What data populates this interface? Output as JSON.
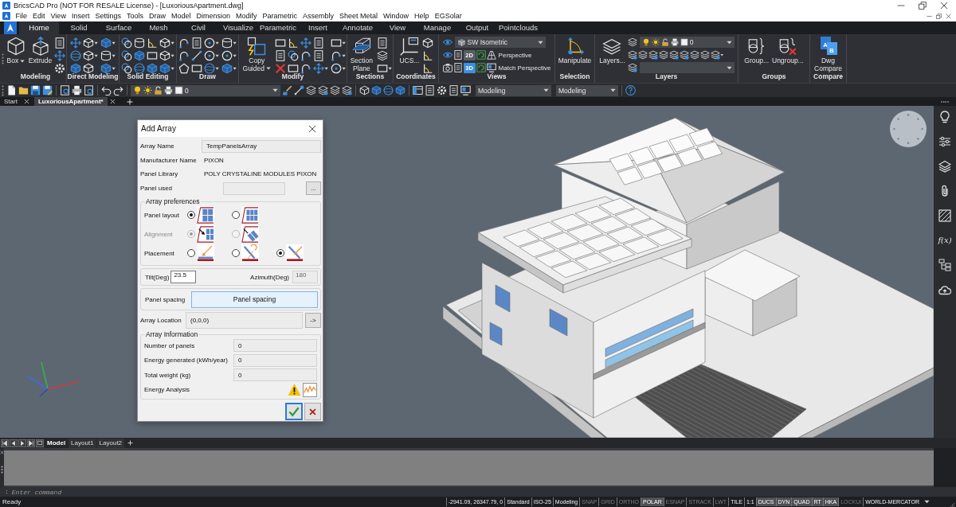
{
  "window": {
    "title": "BricsCAD Pro (NOT FOR RESALE License) - [LuxoriousApartment.dwg]"
  },
  "menu_bar": [
    "File",
    "Edit",
    "View",
    "Insert",
    "Settings",
    "Tools",
    "Draw",
    "Model",
    "Dimension",
    "Modify",
    "Parametric",
    "Assembly",
    "Sheet Metal",
    "Window",
    "Help",
    "EGSolar"
  ],
  "ribbon_tabs": [
    {
      "label": "Home",
      "selected": true
    },
    {
      "label": "Solid",
      "selected": false
    },
    {
      "label": "Surface",
      "selected": false
    },
    {
      "label": "Mesh",
      "selected": false
    },
    {
      "label": "Civil",
      "selected": false
    },
    {
      "label": "Visualize",
      "selected": false
    },
    {
      "label": "Parametric",
      "selected": false
    },
    {
      "label": "Insert",
      "selected": false
    },
    {
      "label": "Annotate",
      "selected": false
    },
    {
      "label": "View",
      "selected": false
    },
    {
      "label": "Manage",
      "selected": false
    },
    {
      "label": "Output",
      "selected": false
    },
    {
      "label": "Pointclouds",
      "selected": false
    }
  ],
  "ribbon_groups": [
    {
      "kind": "buttons",
      "label": "Modeling",
      "buttons": [
        {
          "label": "Box",
          "dropdown": true
        },
        {
          "label": "Extrude",
          "dropdown": false
        }
      ]
    },
    {
      "kind": "buttons",
      "label": "Direct Modeling"
    },
    {
      "kind": "buttons",
      "label": "Solid Editing"
    },
    {
      "kind": "buttons",
      "label": "Draw"
    },
    {
      "kind": "buttons",
      "label": "Modify",
      "buttons": [
        {
          "label": "Copy Guided",
          "dropdown": true
        }
      ]
    },
    {
      "kind": "buttons",
      "label": "Sections",
      "buttons": [
        {
          "label": "Section Plane",
          "dropdown": false
        }
      ]
    },
    {
      "kind": "buttons",
      "label": "Coordinates",
      "buttons": [
        {
          "label": "UCS...",
          "dropdown": false
        }
      ]
    },
    {
      "kind": "views",
      "label": "Views",
      "view": "SW Isometric",
      "modes": [
        {
          "label": "2D",
          "selected": false
        },
        {
          "label": "3D",
          "selected": true
        }
      ],
      "options": [
        "Perspective",
        "Match Perspective"
      ]
    },
    {
      "kind": "buttons",
      "label": "Selection",
      "buttons": [
        {
          "label": "Manipulate",
          "dropdown": false
        }
      ]
    },
    {
      "kind": "layers",
      "label": "Layers",
      "buttons": [
        {
          "label": "Layers...",
          "dropdown": false
        }
      ],
      "layer": "0"
    },
    {
      "kind": "buttons",
      "label": "Groups",
      "buttons": [
        {
          "label": "Group...",
          "dropdown": false
        },
        {
          "label": "Ungroup...",
          "dropdown": false
        }
      ]
    },
    {
      "kind": "buttons",
      "label": "Compare",
      "buttons": [
        {
          "label": "Dwg Compare",
          "dropdown": false,
          "icon_letters": [
            "A",
            "B"
          ]
        }
      ]
    }
  ],
  "quick_toolbar": {
    "layer": "0",
    "combos": [
      "Modeling",
      "Modeling"
    ]
  },
  "document_tabs": [
    {
      "label": "Start",
      "selected": false
    },
    {
      "label": "LuxoriousApartment*",
      "selected": true
    }
  ],
  "dialog": {
    "title": "Add Array",
    "array_name": {
      "label": "Array Name",
      "value": "TempPanelsArray"
    },
    "manufacturer": {
      "label": "Manufacturer Name",
      "value": "PIXON"
    },
    "panel_library": {
      "label": "Panel Library",
      "value": "POLY CRYSTALINE MODULES PIXON"
    },
    "panel_used": {
      "label": "Panel used",
      "disabled": true,
      "button": "..."
    },
    "preferences": {
      "title": "Array preferences",
      "rows": [
        {
          "label": "Panel layout",
          "disabled": false,
          "options": [
            {
              "selected": true
            },
            {
              "selected": false
            }
          ]
        },
        {
          "label": "Alignment",
          "disabled": true,
          "options": [
            {
              "selected": true
            },
            {
              "selected": false
            }
          ]
        },
        {
          "label": "Placement",
          "disabled": false,
          "options": [
            {
              "selected": false
            },
            {
              "selected": false
            },
            {
              "selected": true
            }
          ]
        }
      ]
    },
    "tilt": {
      "label": "Tilt(Deg)",
      "value": "23.5"
    },
    "azimuth": {
      "label": "Azimuth(Deg)",
      "value": "180",
      "disabled": true
    },
    "panel_spacing": {
      "label": "Panel spacing",
      "button": "Panel spacing"
    },
    "location": {
      "label": "Array Location",
      "value": "(0,0,0)",
      "button": "->"
    },
    "info": {
      "title": "Array Information",
      "rows": [
        {
          "label": "Number of panels",
          "value": "0"
        },
        {
          "label": "Energy generated (kWh/year)",
          "value": "0"
        },
        {
          "label": "Total weight (kg)",
          "value": "0"
        }
      ],
      "analysis_label": "Energy Analysis"
    }
  },
  "side_toolbar": {
    "formula": "f(x)"
  },
  "layout_tabs": [
    {
      "label": "Model",
      "selected": true
    },
    {
      "label": "Layout1",
      "selected": false
    },
    {
      "label": "Layout2",
      "selected": false
    }
  ],
  "command_line": {
    "prompt": ":",
    "placeholder": "Enter command"
  },
  "status_bar": {
    "message": "Ready",
    "items": [
      {
        "kind": "readout",
        "label": "-2941.09, 26347.79, 0"
      },
      {
        "kind": "readout",
        "label": "Standard"
      },
      {
        "kind": "readout",
        "label": "ISO-25"
      },
      {
        "kind": "readout",
        "label": "Modeling"
      },
      {
        "kind": "toggle",
        "label": "SNAP",
        "on": false
      },
      {
        "kind": "toggle",
        "label": "GRID",
        "on": false
      },
      {
        "kind": "toggle",
        "label": "ORTHO",
        "on": false
      },
      {
        "kind": "toggle",
        "label": "POLAR",
        "on": true
      },
      {
        "kind": "toggle",
        "label": "ESNAP",
        "on": false
      },
      {
        "kind": "toggle",
        "label": "STRACK",
        "on": false
      },
      {
        "kind": "toggle",
        "label": "LWT",
        "on": false
      },
      {
        "kind": "readout",
        "label": "TILE"
      },
      {
        "kind": "readout",
        "label": "1:1"
      },
      {
        "kind": "toggle",
        "label": "DUCS",
        "on": true
      },
      {
        "kind": "toggle",
        "label": "DYN",
        "on": true
      },
      {
        "kind": "toggle",
        "label": "QUAD",
        "on": true
      },
      {
        "kind": "toggle",
        "label": "RT",
        "on": true
      },
      {
        "kind": "toggle",
        "label": "HKA",
        "on": true
      },
      {
        "kind": "toggle",
        "label": "LOCKUI",
        "on": false
      },
      {
        "kind": "readout",
        "label": "WORLD-MERCATOR"
      }
    ]
  }
}
